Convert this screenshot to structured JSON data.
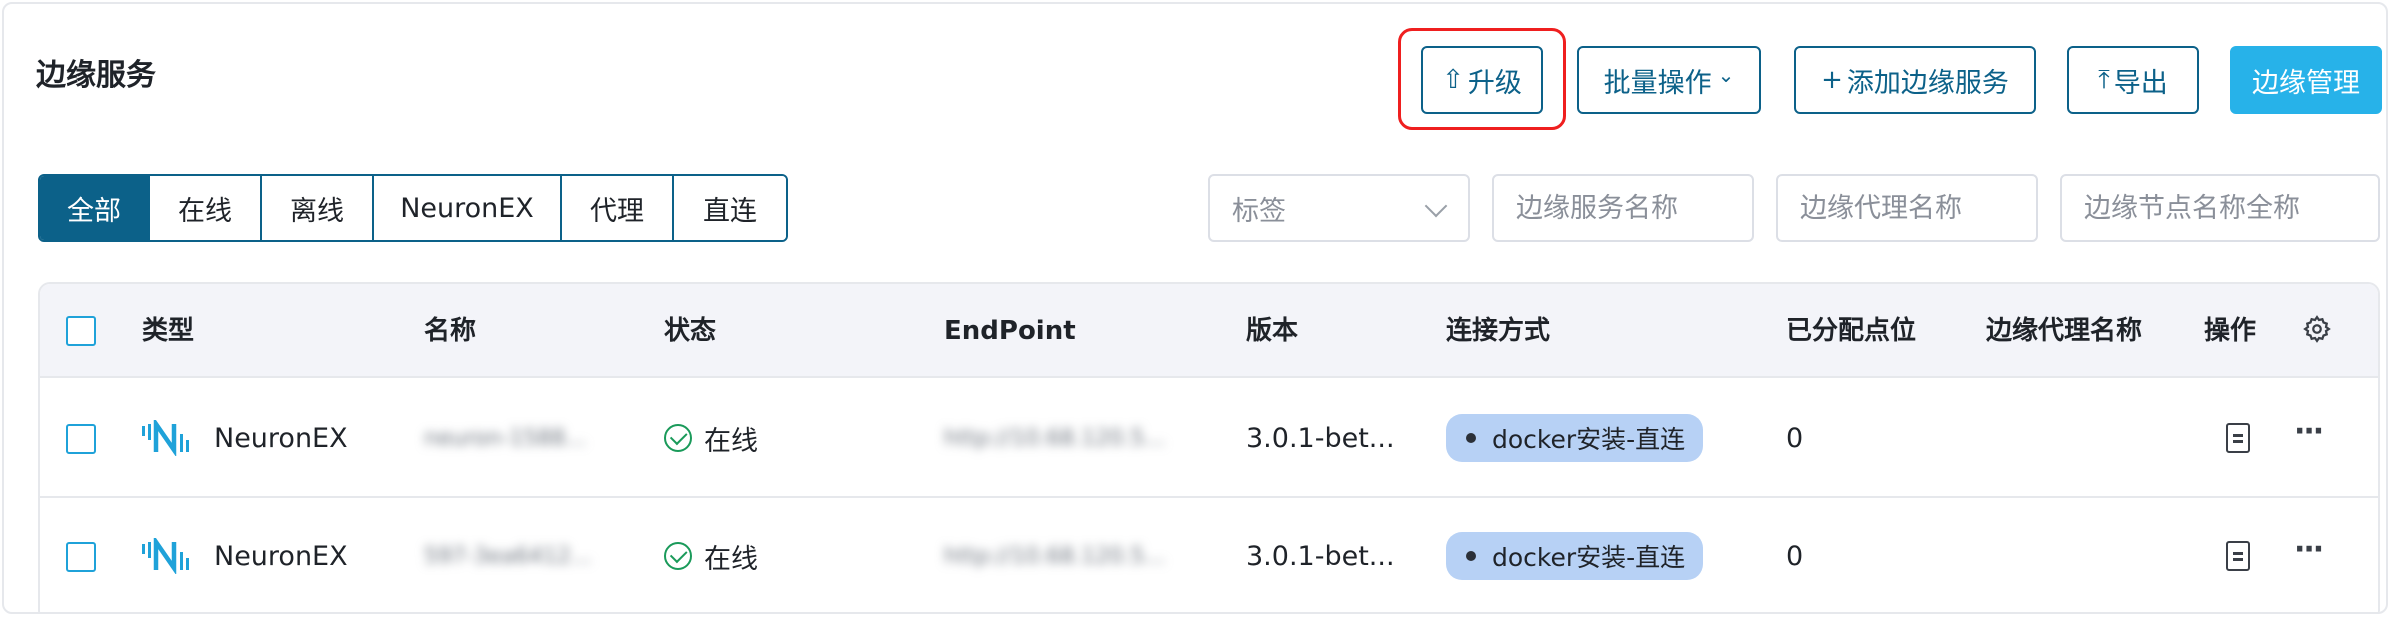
{
  "page": {
    "title": "边缘服务"
  },
  "toolbar": {
    "upgrade": {
      "icon": "⇧",
      "label": "升级"
    },
    "batch": {
      "label": "批量操作",
      "caret": "⌄"
    },
    "add": {
      "icon": "+",
      "label": "添加边缘服务"
    },
    "export": {
      "icon": "⤒",
      "label": "导出"
    },
    "manage": {
      "label": "边缘管理"
    }
  },
  "tabs": [
    {
      "label": "全部",
      "active": true
    },
    {
      "label": "在线",
      "active": false
    },
    {
      "label": "离线",
      "active": false
    },
    {
      "label": "NeuronEX",
      "active": false
    },
    {
      "label": "代理",
      "active": false
    },
    {
      "label": "直连",
      "active": false
    }
  ],
  "filters": {
    "tag_select": {
      "placeholder": "标签"
    },
    "service_name": {
      "placeholder": "边缘服务名称"
    },
    "agent_name": {
      "placeholder": "边缘代理名称"
    },
    "node_name": {
      "placeholder": "边缘节点名称全称"
    }
  },
  "table": {
    "columns": [
      "类型",
      "名称",
      "状态",
      "EndPoint",
      "版本",
      "连接方式",
      "已分配点位",
      "边缘代理名称",
      "操作"
    ],
    "rows": [
      {
        "type": "NeuronEX",
        "name": "neuron-1588...",
        "status": "在线",
        "endpoint": "http://10.68.120.5...",
        "version": "3.0.1-bet...",
        "connection": "docker安装-直连",
        "points": "0",
        "agent": ""
      },
      {
        "type": "NeuronEX",
        "name": "597-3ea6412...",
        "status": "在线",
        "endpoint": "http://10.68.120.5...",
        "version": "3.0.1-bet...",
        "connection": "docker安装-直连",
        "points": "0",
        "agent": ""
      }
    ]
  },
  "colors": {
    "primary": "#0c6189",
    "accent": "#27b2e9",
    "highlight": "#ef1f1f",
    "online": "#1a9a5a",
    "tag_bg": "#b7d1f5",
    "header_bg": "#f3f4f9"
  }
}
